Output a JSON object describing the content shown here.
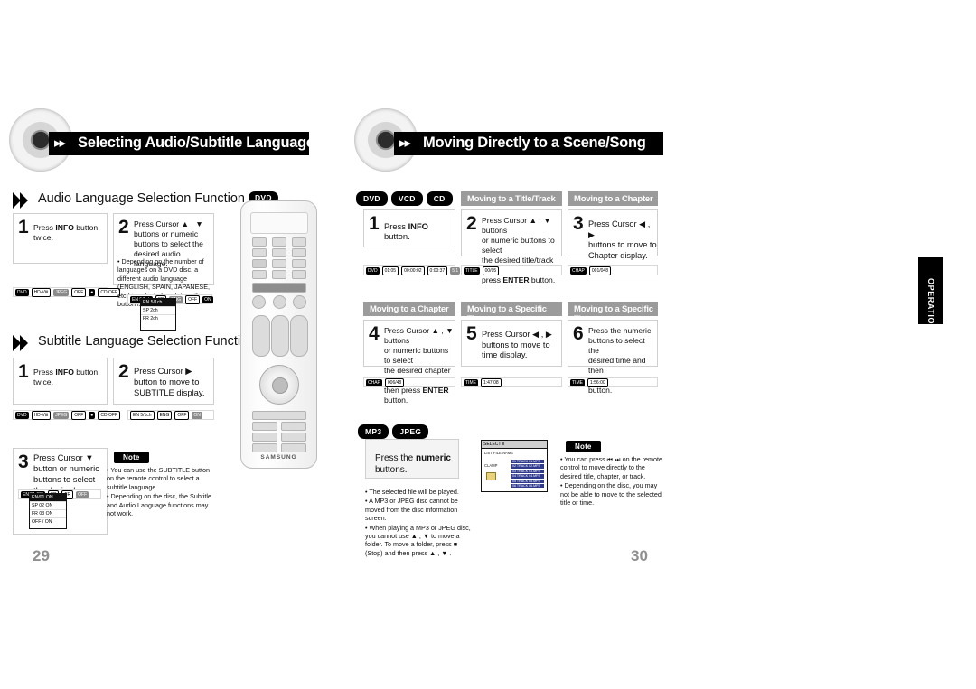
{
  "page": {
    "left_number": "29",
    "right_number": "30",
    "operation_tab": "OPERATION"
  },
  "left": {
    "heading": "Selecting Audio/Subtitle Language",
    "sections": [
      {
        "title": "Audio Language Selection Function",
        "tag": "DVD"
      },
      {
        "title": "Subtitle Language Selection Function",
        "tag": "DVD"
      }
    ],
    "audio_steps": [
      {
        "num": "1",
        "lines": [
          "Press INFO button",
          "twice."
        ],
        "bold": "INFO"
      },
      {
        "num": "2",
        "lines": [
          "Press Cursor ▲ , ▼",
          "buttons or numeric",
          "buttons to select the",
          "desired audio language."
        ]
      }
    ],
    "audio_note": "• Depending on the number of languages on a DVD disc, a different audio language (ENGLISH, SPAIN, JAPANESE, etc.) is selected each time the button is pressed.",
    "subtitle_steps": [
      {
        "num": "1",
        "lines": [
          "Press INFO button",
          "twice."
        ],
        "bold": "INFO"
      },
      {
        "num": "2",
        "lines": [
          "Press Cursor ▶",
          "button to move to",
          "SUBTITLE display."
        ]
      },
      {
        "num": "3",
        "lines": [
          "Press Cursor ▼",
          "button or numeric",
          "buttons to select",
          "the desired subtitle."
        ]
      }
    ],
    "note_badge": "Note",
    "notes": [
      "• You can use the SUBTITLE button on the remote control to select a subtitle language.",
      "• Depending on the disc, the Subtitle and Audio Language functions may not work."
    ],
    "strips": [
      [
        "DVD",
        "HD-VIDEO",
        "HD-JPEG",
        "DVD-R/RW",
        "MP3",
        "CD"
      ],
      [
        "DVD",
        "HD-VIDEO",
        "HD-JPEG",
        "DVD-R/RW",
        "MP3",
        "CD"
      ]
    ],
    "osd_audio": {
      "rows": [
        "EN 5/1ch",
        "SP 2ch",
        "FR 2ch"
      ],
      "selected": 0
    },
    "osd_sub": {
      "rows": [
        "EN/01 ON",
        "SP 02 ON",
        "FR 03 ON",
        "OFF / ON"
      ],
      "selected": 0
    },
    "osd_mini_bar": [
      "EN",
      "5.1ch",
      "ENG",
      "OFF",
      "ON"
    ]
  },
  "right": {
    "heading": "Moving Directly to a Scene/Song",
    "disc_tags_top": [
      "DVD",
      "VCD",
      "CD"
    ],
    "disc_tags_bottom": [
      "MP3",
      "JPEG"
    ],
    "panels": [
      {
        "title": "",
        "num": "1",
        "lines": [
          "Press INFO button."
        ],
        "bold": "INFO"
      },
      {
        "title": "Moving to a Title/Track",
        "num": "2",
        "lines": [
          "Press Cursor ▲ , ▼ buttons",
          "or numeric buttons to select",
          "the desired title/track and then",
          "press ENTER button."
        ]
      },
      {
        "title": "Moving to a Chapter",
        "num": "3",
        "lines": [
          "Press Cursor ◀ , ▶",
          "buttons to move to",
          "Chapter display."
        ]
      },
      {
        "title": "Moving to a Chapter",
        "num": "4",
        "lines": [
          "Press Cursor ▲ , ▼ buttons",
          "or numeric buttons to select",
          "the desired chapter and",
          "then press ENTER button."
        ]
      },
      {
        "title": "Moving to a Specific Time",
        "num": "5",
        "lines": [
          "Press Cursor ◀ , ▶",
          "buttons to move to",
          "time display."
        ]
      },
      {
        "title": "Moving to a Specific Time",
        "num": "6",
        "lines": [
          "Press the numeric",
          "buttons to select the",
          "desired time and then",
          "press ENTER button."
        ]
      }
    ],
    "panel_strips": [
      [
        "DVD",
        "01:05",
        "00:00:02",
        "00:00:37",
        "5.1"
      ],
      [
        "TITLE",
        "00/05"
      ],
      [
        "CHAP",
        "001/048"
      ],
      [
        "CHAP",
        "006/48"
      ],
      [
        "TIME",
        "1:47:08"
      ],
      [
        "TIME",
        "1:56:00"
      ]
    ],
    "mp3_panel": {
      "lines": [
        "Press the numeric",
        "buttons."
      ],
      "bold": "numeric",
      "notes": [
        "• The selected file will be played.",
        "• A MP3 or JPEG disc cannot be moved from the disc information screen.",
        "• When playing a MP3 or JPEG disc, you cannot use ▲ , ▼ to move a folder. To move a folder, press ■ (Stop) and then press ▲ , ▼ ."
      ]
    },
    "note_badge": "Note",
    "notes": [
      "• You can press ⏮ ⏭ on the remote control to move directly to the desired title, chapter, or track.",
      "• Depending on the disc, you may not be able to move to the selected title or time."
    ],
    "tv": {
      "header": "SELECT Ⅱ",
      "labels": [
        "LIST FILE NAME",
        "CLAMP"
      ],
      "items": [
        "01 TRACK 01.MP3",
        "02 TRACK 02.MP3",
        "03 TRACK 03.MP3",
        "04 TRACK 04.MP3",
        "05 TRACK 05.MP3",
        "06 TRACK 06.MP3"
      ]
    }
  }
}
